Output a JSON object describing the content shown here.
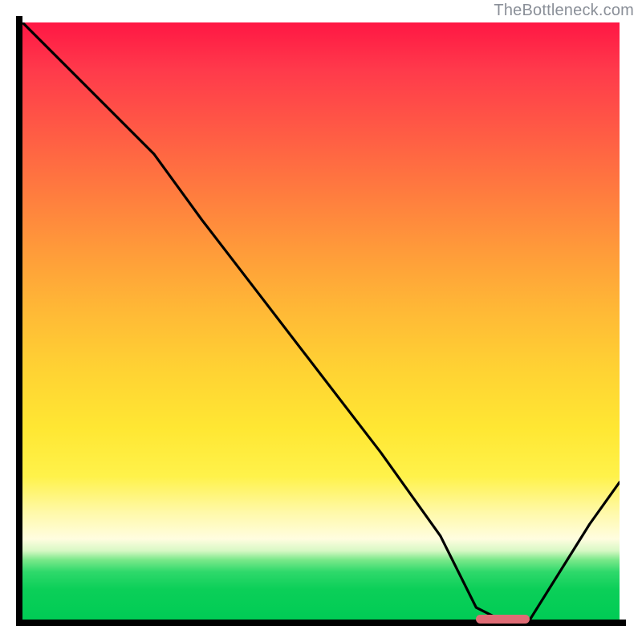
{
  "watermark": {
    "text": "TheBottleneck.com"
  },
  "colors": {
    "gradient_top": "#ff1744",
    "gradient_mid": "#ffd233",
    "gradient_bottom": "#00cc55",
    "curve": "#000000",
    "axes": "#000000",
    "marker": "#e06c75"
  },
  "chart_data": {
    "type": "line",
    "title": "",
    "xlabel": "",
    "ylabel": "",
    "xlim": [
      0,
      100
    ],
    "ylim": [
      0,
      100
    ],
    "legend": false,
    "grid": false,
    "description": "A single black curve on a vertical red→yellow→green heat gradient. The curve starts near the top-left at 100%, kinks around x≈22 to a shallower slope, descends steeply and nearly linearly to a minimum of ~0 around x≈77–85 (flat valley marked by a pink pill), then rises to ~23% at the right edge.",
    "series": [
      {
        "name": "bottleneck-curve",
        "x": [
          0,
          10,
          22,
          30,
          40,
          50,
          60,
          70,
          76,
          80,
          85,
          90,
          95,
          100
        ],
        "y": [
          100,
          90,
          78,
          67,
          54,
          41,
          28,
          14,
          2,
          0,
          0,
          8,
          16,
          23
        ]
      }
    ],
    "annotations": [
      {
        "name": "optimal-range-marker",
        "x_start": 76,
        "x_end": 85,
        "y": 0
      }
    ]
  }
}
